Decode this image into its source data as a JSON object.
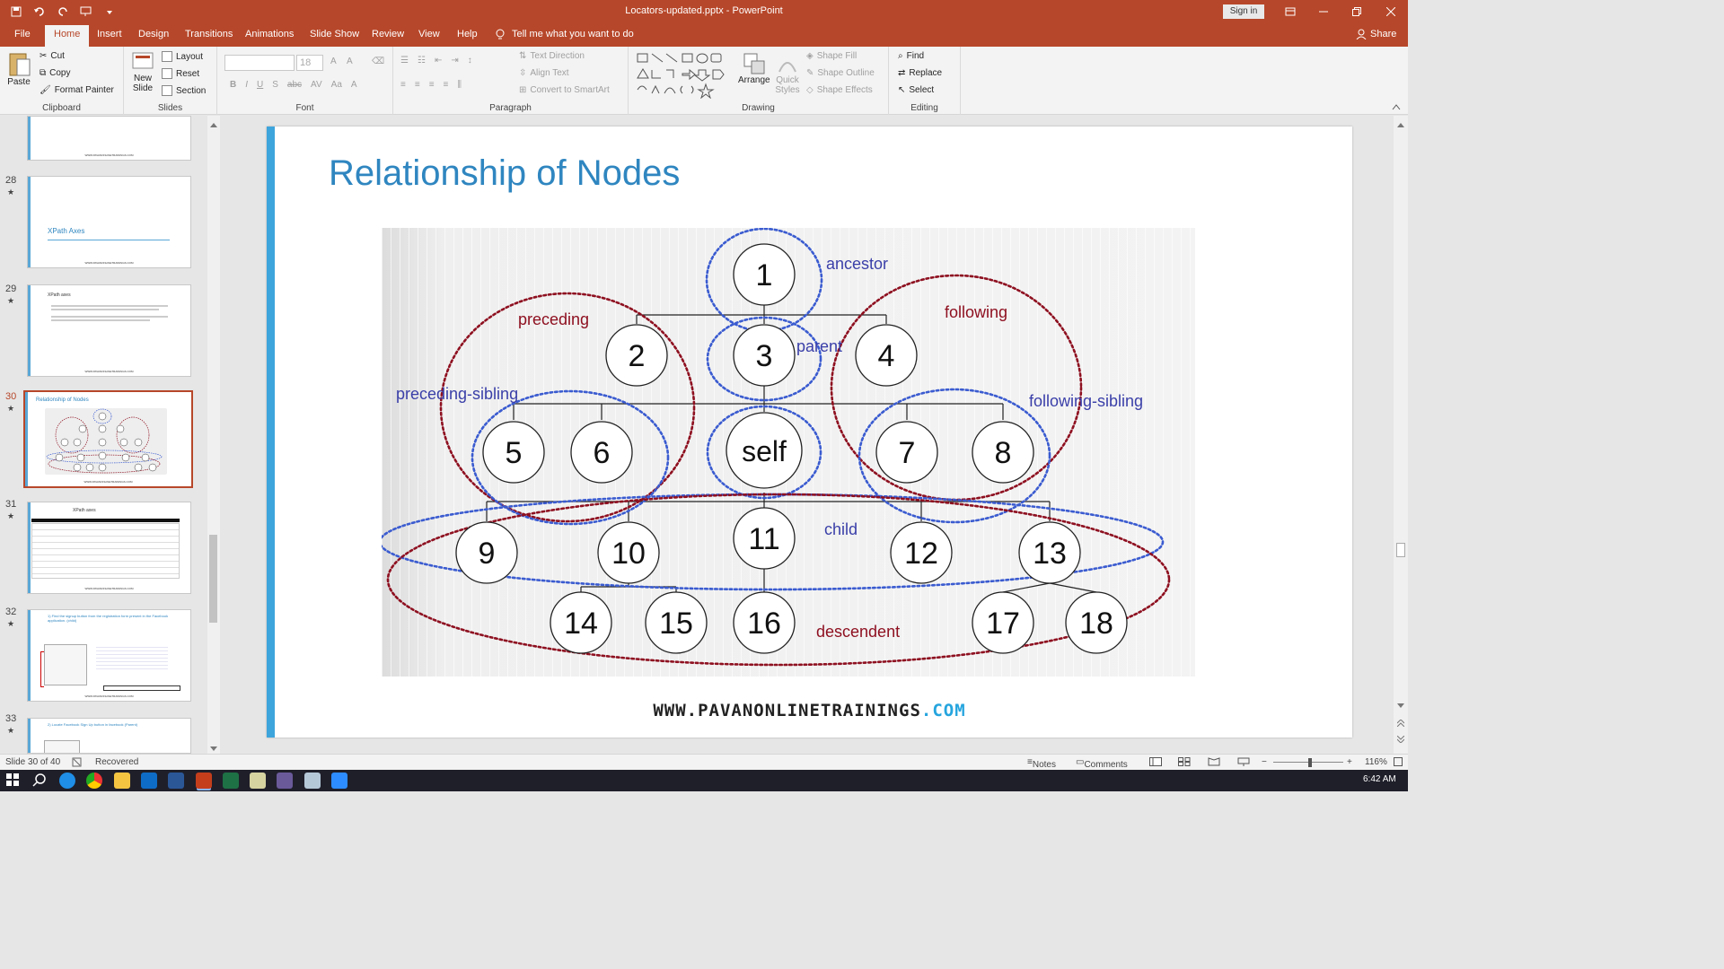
{
  "window": {
    "title": "Locators-updated.pptx  -  PowerPoint",
    "signin_label": "Sign in"
  },
  "tabs": [
    "File",
    "Home",
    "Insert",
    "Design",
    "Transitions",
    "Animations",
    "Slide Show",
    "Review",
    "View",
    "Help"
  ],
  "active_tab": "Home",
  "tellme": "Tell me what you want to do",
  "share": "Share",
  "ribbon": {
    "clipboard": {
      "paste": "Paste",
      "cut": "Cut",
      "copy": "Copy",
      "format_painter": "Format Painter",
      "label": "Clipboard"
    },
    "slides": {
      "new_slide": "New Slide",
      "layout": "Layout",
      "reset": "Reset",
      "section": "Section",
      "label": "Slides"
    },
    "font": {
      "size": "18",
      "label": "Font"
    },
    "paragraph": {
      "text_direction": "Text Direction",
      "align_text": "Align Text",
      "smartart": "Convert to SmartArt",
      "label": "Paragraph"
    },
    "drawing": {
      "arrange": "Arrange",
      "quick_styles": "Quick Styles",
      "shape_fill": "Shape Fill",
      "shape_outline": "Shape Outline",
      "shape_effects": "Shape Effects",
      "label": "Drawing"
    },
    "editing": {
      "find": "Find",
      "replace": "Replace",
      "select": "Select",
      "label": "Editing"
    }
  },
  "thumbnails": [
    {
      "num": "28",
      "title": "XPath Axes"
    },
    {
      "num": "29",
      "title": "XPath axes"
    },
    {
      "num": "30",
      "title": "Relationship of Nodes"
    },
    {
      "num": "31",
      "title": "XPath axes"
    },
    {
      "num": "32",
      "title": "1) Find the signup button from the registration form present in the Facebook application. (child)"
    },
    {
      "num": "33",
      "title": "2) Locate Facebook Sign Up button in facebook (Parent)"
    }
  ],
  "thumb_footer": "WWW.PAVANONLINETRAININGS.COM",
  "slide": {
    "title": "Relationship of Nodes",
    "footer_main": "WWW.PAVANONLINETRAININGS",
    "footer_dot": ".COM"
  },
  "diagram": {
    "nodes": [
      "1",
      "2",
      "3",
      "4",
      "5",
      "6",
      "self",
      "7",
      "8",
      "9",
      "10",
      "11",
      "12",
      "13",
      "14",
      "15",
      "16",
      "17",
      "18"
    ],
    "labels": {
      "ancestor": "ancestor",
      "preceding": "preceding",
      "parent": "parent",
      "following": "following",
      "preceding_sibling": "preceding-sibling",
      "following_sibling": "following-sibling",
      "child": "child",
      "descendent": "descendent"
    },
    "colors": {
      "blue": "#3a5bd0",
      "red": "#8e1020",
      "blue_text": "#3a3fa8",
      "red_text": "#8e1020"
    }
  },
  "status": {
    "slide_info": "Slide 30 of 40",
    "recovered": "Recovered",
    "notes": "Notes",
    "comments": "Comments",
    "zoom": "116%"
  },
  "taskbar": {
    "time": "6:42 AM"
  }
}
